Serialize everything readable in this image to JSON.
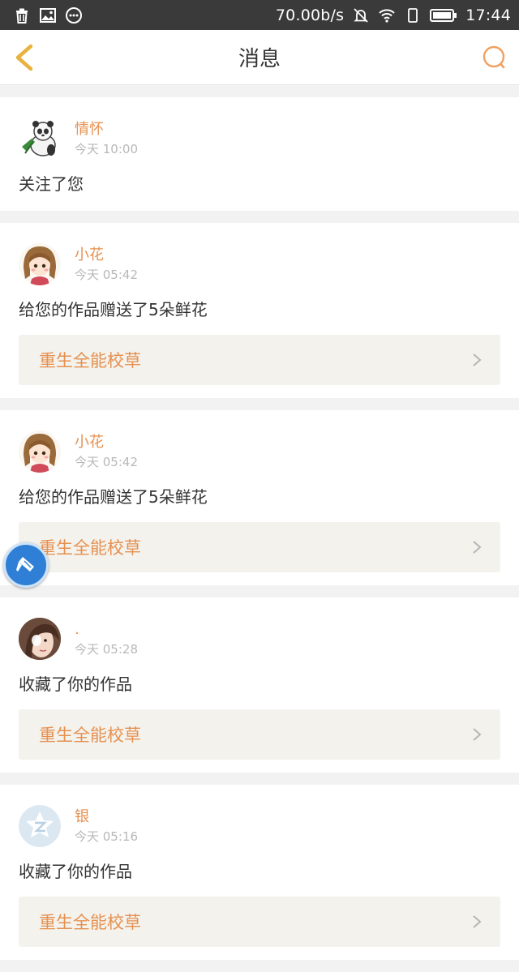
{
  "status_bar": {
    "left_icons": [
      "trash-icon",
      "image-icon",
      "more-circle-icon"
    ],
    "speed": "70.00b/s",
    "right_icons": [
      "mute-icon",
      "wifi-icon",
      "portrait-lock-icon",
      "battery-icon"
    ],
    "time": "17:44"
  },
  "header": {
    "title": "消息",
    "accent_color": "#e9b23e",
    "search_color": "#f0a060"
  },
  "messages": [
    {
      "name": "情怀",
      "time": "今天 10:00",
      "text": "关注了您",
      "work": "",
      "avatar": "panda-avatar"
    },
    {
      "name": "小花",
      "time": "今天 05:42",
      "text": "给您的作品赠送了5朵鲜花",
      "work": "重生全能校草",
      "avatar": "cartoon-girl-avatar"
    },
    {
      "name": "小花",
      "time": "今天 05:42",
      "text": "给您的作品赠送了5朵鲜花",
      "work": "重生全能校草",
      "avatar": "cartoon-girl-avatar"
    },
    {
      "name": ".",
      "time": "今天 05:28",
      "text": "收藏了你的作品",
      "work": "重生全能校草",
      "avatar": "photo-avatar"
    },
    {
      "name": "银",
      "time": "今天 05:16",
      "text": "收藏了你的作品",
      "work": "重生全能校草",
      "avatar": "default-qq-avatar"
    }
  ],
  "floating_button": {
    "icon": "brush-icon",
    "color": "#2f7fd6"
  }
}
